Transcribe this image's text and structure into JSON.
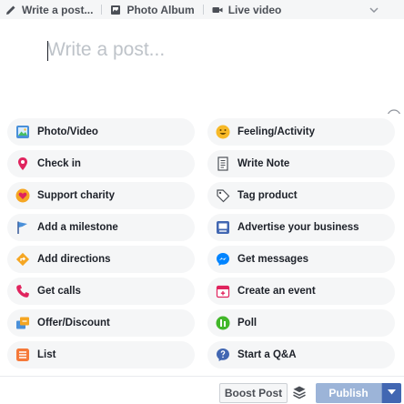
{
  "tabs": [
    {
      "label": "Write a post...",
      "icon": "pencil-icon"
    },
    {
      "label": "Photo Album",
      "icon": "photo-album-icon"
    },
    {
      "label": "Live video",
      "icon": "video-camera-icon"
    }
  ],
  "composer": {
    "placeholder": "Write a post...",
    "value": ""
  },
  "options": [
    {
      "label": "Photo/Video",
      "icon": "photo-video-icon"
    },
    {
      "label": "Feeling/Activity",
      "icon": "smiley-icon"
    },
    {
      "label": "Check in",
      "icon": "location-pin-icon"
    },
    {
      "label": "Write Note",
      "icon": "note-icon"
    },
    {
      "label": "Support charity",
      "icon": "charity-icon"
    },
    {
      "label": "Tag product",
      "icon": "tag-icon"
    },
    {
      "label": "Add a milestone",
      "icon": "flag-icon"
    },
    {
      "label": "Advertise your business",
      "icon": "advertise-icon"
    },
    {
      "label": "Add directions",
      "icon": "directions-icon"
    },
    {
      "label": "Get messages",
      "icon": "messenger-icon"
    },
    {
      "label": "Get calls",
      "icon": "phone-icon"
    },
    {
      "label": "Create an event",
      "icon": "calendar-icon"
    },
    {
      "label": "Offer/Discount",
      "icon": "offer-icon"
    },
    {
      "label": "Poll",
      "icon": "poll-icon"
    },
    {
      "label": "List",
      "icon": "list-icon"
    },
    {
      "label": "Start a Q&A",
      "icon": "question-icon"
    }
  ],
  "footer": {
    "boost_label": "Boost Post",
    "publish_label": "Publish"
  },
  "colors": {
    "brand_blue": "#4267b2",
    "publish_disabled": "#9cb4d8",
    "chip_bg": "#f5f6f7"
  }
}
